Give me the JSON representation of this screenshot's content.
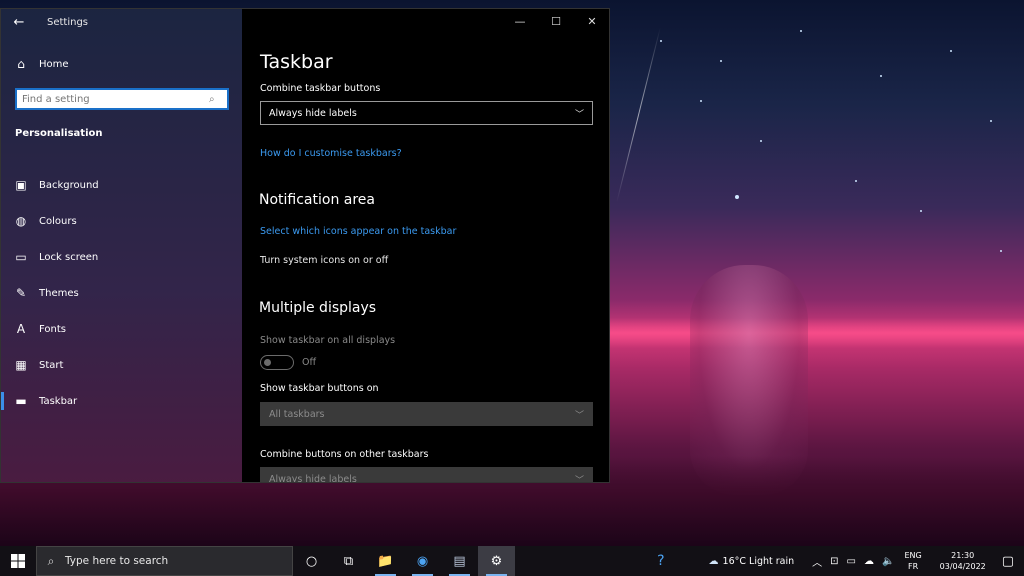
{
  "window": {
    "app_title": "Settings",
    "controls": {
      "minimize": "—",
      "maximize": "☐",
      "close": "✕"
    }
  },
  "sidebar": {
    "home": "Home",
    "search_placeholder": "Find a setting",
    "section": "Personalisation",
    "items": [
      {
        "label": "Background",
        "icon": "image-icon",
        "glyph": "▣"
      },
      {
        "label": "Colours",
        "icon": "palette-icon",
        "glyph": "◍"
      },
      {
        "label": "Lock screen",
        "icon": "lock-screen-icon",
        "glyph": "▭"
      },
      {
        "label": "Themes",
        "icon": "themes-icon",
        "glyph": "✎"
      },
      {
        "label": "Fonts",
        "icon": "fonts-icon",
        "glyph": "A"
      },
      {
        "label": "Start",
        "icon": "start-icon",
        "glyph": "▦"
      },
      {
        "label": "Taskbar",
        "icon": "taskbar-icon",
        "glyph": "▬",
        "active": true
      }
    ]
  },
  "content": {
    "title": "Taskbar",
    "combine_label": "Combine taskbar buttons",
    "combine_value": "Always hide labels",
    "customise_link": "How do I customise taskbars?",
    "notification_title": "Notification area",
    "select_icons_link": "Select which icons appear on the taskbar",
    "system_icons_text": "Turn system icons on or off",
    "multiple_title": "Multiple displays",
    "show_all_label": "Show taskbar on all displays",
    "show_all_state": "Off",
    "show_buttons_label": "Show taskbar buttons on",
    "show_buttons_value": "All taskbars",
    "combine_other_label": "Combine buttons on other taskbars",
    "combine_other_value": "Always hide labels"
  },
  "taskbar": {
    "search_placeholder": "Type here to search",
    "pinned": [
      {
        "name": "cortana-icon",
        "glyph": "○"
      },
      {
        "name": "task-view-icon",
        "glyph": "⧉"
      },
      {
        "name": "file-explorer-icon",
        "glyph": "📁",
        "running": true
      },
      {
        "name": "chrome-icon",
        "glyph": "◉",
        "running": true
      },
      {
        "name": "app-icon",
        "glyph": "▤",
        "running": true
      },
      {
        "name": "settings-icon",
        "glyph": "⚙",
        "running": true,
        "active": true
      }
    ],
    "weather": "16°C  Light rain",
    "lang_top": "ENG",
    "lang_bottom": "FR",
    "time": "21:30",
    "date": "03/04/2022"
  },
  "colors": {
    "accent": "#3b8fe8",
    "link": "#3b9af0"
  }
}
